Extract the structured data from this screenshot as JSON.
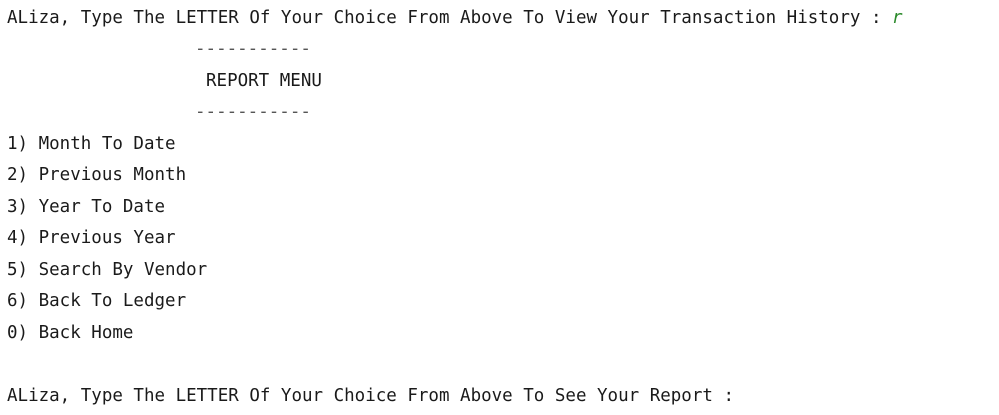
{
  "console": {
    "prompt_top": "ALiza, Type The LETTER Of Your Choice From Above To View Your Transaction History : ",
    "user_input": "r",
    "divider_top": "-----------",
    "menu_title": "REPORT MENU",
    "divider_bottom": "-----------",
    "options": [
      "1) Month To Date",
      "2) Previous Month",
      "3) Year To Date",
      "4) Previous Year",
      "5) Search By Vendor",
      "6) Back To Ledger",
      "0) Back Home"
    ],
    "prompt_bottom": "ALiza, Type The LETTER Of Your Choice From Above To See Your Report : ",
    "colors": {
      "text": "#1a1a1a",
      "user_input": "#2b8a2b",
      "background": "#ffffff"
    }
  }
}
